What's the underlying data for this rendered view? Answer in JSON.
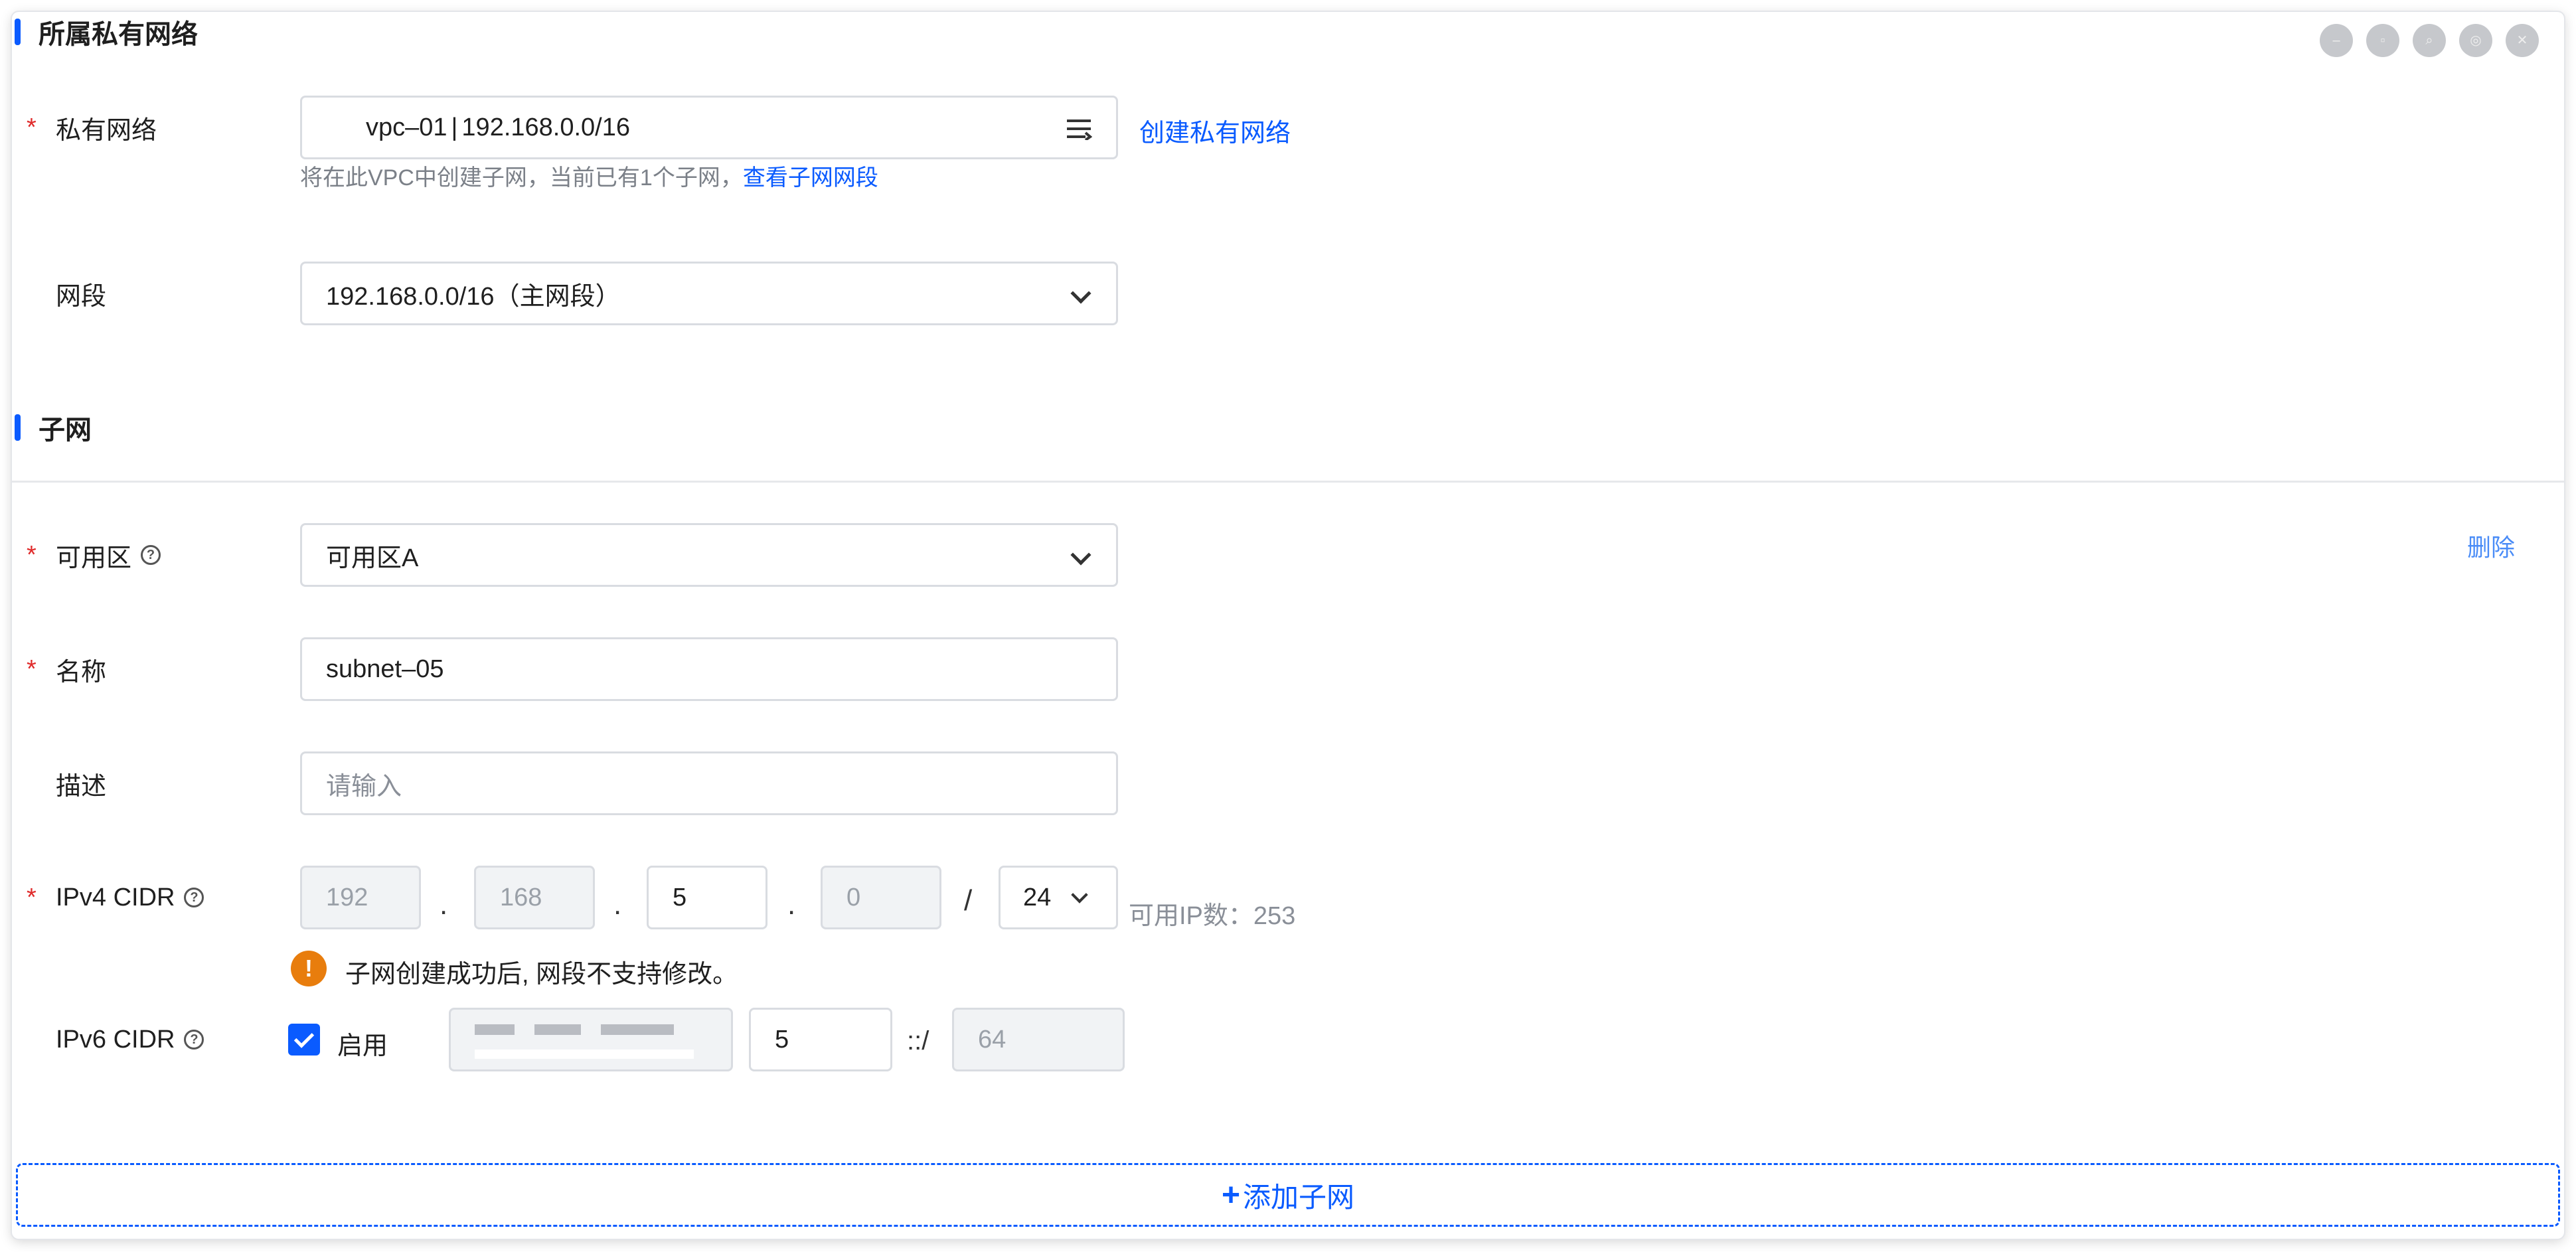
{
  "window_controls": [
    "minimize-icon",
    "restore-icon",
    "zoom-icon",
    "settings-icon",
    "close-icon"
  ],
  "vpc_section": {
    "title": "所属私有网络",
    "vpc_label": "私有网络",
    "vpc_name": "vpc–01",
    "vpc_cidr": "192.168.0.0/16",
    "create_vpc_link": "创建私有网络",
    "hint_prefix": "将在此VPC中创建子网，当前已有1个子网，",
    "hint_link": "查看子网网段",
    "segment_label": "网段",
    "segment_value": "192.168.0.0/16（主网段）"
  },
  "subnet_section": {
    "title": "子网",
    "delete_link": "删除",
    "az_label": "可用区",
    "az_value": "可用区A",
    "name_label": "名称",
    "name_value": "subnet–05",
    "desc_label": "描述",
    "desc_placeholder": "请输入",
    "ipv4_label": "IPv4 CIDR",
    "ipv4_octets": [
      "192",
      "168",
      "5",
      "0"
    ],
    "ipv4_dot": ".",
    "ipv4_slash": "/",
    "ipv4_mask": "24",
    "available_ip_label": "可用IP数：",
    "available_ip_count": "253",
    "warning_text": "子网创建成功后, 网段不支持修改。",
    "ipv6_label": "IPv6 CIDR",
    "ipv6_enable_label": "启用",
    "ipv6_enabled": true,
    "ipv6_subnet": "5",
    "ipv6_separator": "::/",
    "ipv6_prefix": "64"
  },
  "add_subnet_label": "添加子网",
  "colors": {
    "accent": "#0a5bff",
    "required": "#e02b2b",
    "warning": "#e87d0d"
  }
}
